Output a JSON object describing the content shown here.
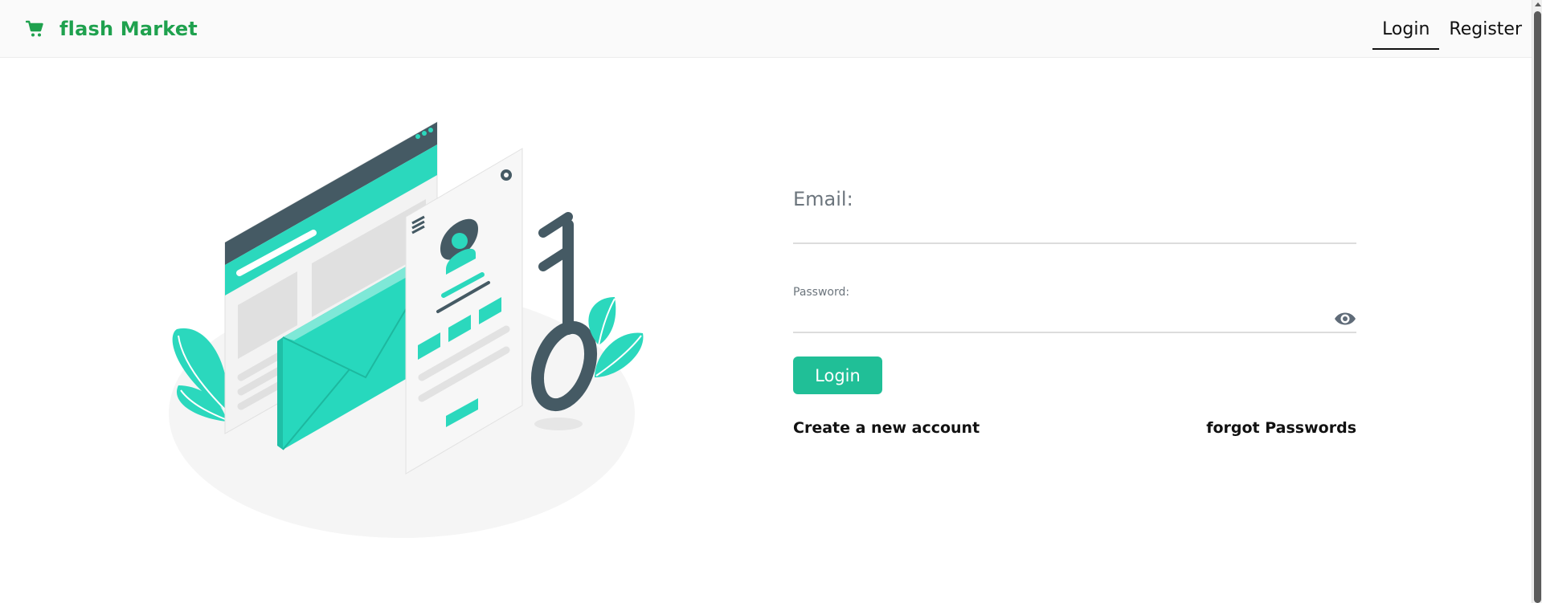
{
  "header": {
    "brand_name": "flash Market",
    "brand_icon": "shopping-cart-icon",
    "nav": {
      "login": "Login",
      "register": "Register",
      "active": "Login"
    }
  },
  "login_form": {
    "email_label": "Email:",
    "email_value": "",
    "password_label": "Password:",
    "password_value": "",
    "show_password_icon": "eye-icon",
    "submit_label": "Login",
    "create_account_link": "Create a new account",
    "forgot_password_link": "forgot Passwords"
  },
  "colors": {
    "brand": "#1fa14e",
    "accent": "#20bf97",
    "illustration_teal": "#2bd8bd",
    "illustration_dark": "#455a64"
  }
}
